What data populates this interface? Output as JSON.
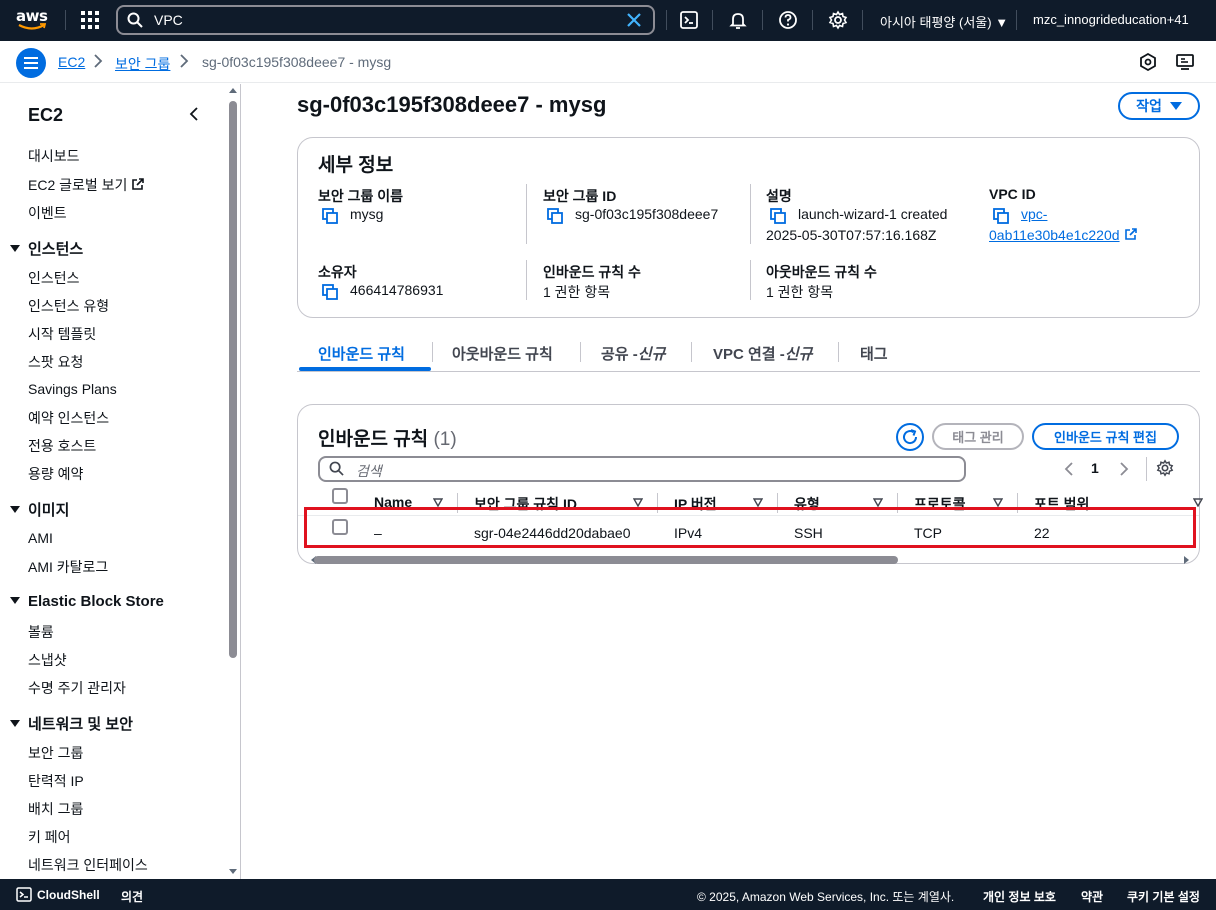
{
  "topnav": {
    "logo_text": "aws",
    "search_value": "VPC",
    "region_label": "아시아 태평양 (서울)",
    "account_label": "mzc_innogrideducation+41"
  },
  "breadcrumb": {
    "items": [
      "EC2",
      "보안 그룹",
      "sg-0f03c195f308deee7 - mysg"
    ]
  },
  "sidebar": {
    "title": "EC2",
    "top_items": [
      "대시보드",
      "EC2 글로벌 보기",
      "이벤트"
    ],
    "sections": [
      {
        "title": "인스턴스",
        "items": [
          "인스턴스",
          "인스턴스 유형",
          "시작 템플릿",
          "스팟 요청",
          "Savings Plans",
          "예약 인스턴스",
          "전용 호스트",
          "용량 예약"
        ]
      },
      {
        "title": "이미지",
        "items": [
          "AMI",
          "AMI 카탈로그"
        ]
      },
      {
        "title": "Elastic Block Store",
        "items": [
          "볼륨",
          "스냅샷",
          "수명 주기 관리자"
        ]
      },
      {
        "title": "네트워크 및 보안",
        "items": [
          "보안 그룹",
          "탄력적 IP",
          "배치 그룹",
          "키 페어",
          "네트워크 인터페이스"
        ]
      }
    ]
  },
  "page": {
    "title": "sg-0f03c195f308deee7 - mysg",
    "action_button": "작업"
  },
  "details": {
    "title": "세부 정보",
    "fields": {
      "sg_name_label": "보안 그룹 이름",
      "sg_name_value": "mysg",
      "sg_id_label": "보안 그룹 ID",
      "sg_id_value": "sg-0f03c195f308deee7",
      "desc_label": "설명",
      "desc_value_line1": "launch-wizard-1 created",
      "desc_value_line2": "2025-05-30T07:57:16.168Z",
      "vpc_label": "VPC ID",
      "vpc_value_line1": "vpc-",
      "vpc_value_line2": "0ab11e30b4e1c220d",
      "owner_label": "소유자",
      "owner_value": "466414786931",
      "inbound_count_label": "인바운드 규칙 수",
      "inbound_count_value": "1 권한 항목",
      "outbound_count_label": "아웃바운드 규칙 수",
      "outbound_count_value": "1 권한 항목"
    }
  },
  "tabs": [
    {
      "label": "인바운드 규칙"
    },
    {
      "label": "아웃바운드 규칙"
    },
    {
      "label": "공유 -",
      "suffix": "신규"
    },
    {
      "label": "VPC 연결 -",
      "suffix": "신규"
    },
    {
      "label": "태그"
    }
  ],
  "rules": {
    "title": "인바운드 규칙",
    "count": "(1)",
    "manage_tags_button": "태그 관리",
    "edit_button": "인바운드 규칙 편집",
    "search_placeholder": "검색",
    "page_number": "1",
    "columns": [
      "Name",
      "보안 그룹 규칙 ID",
      "IP 버전",
      "유형",
      "프로토콜",
      "포트 범위"
    ],
    "rows": [
      {
        "name": "–",
        "rule_id": "sgr-04e2446dd20dabae0",
        "ip_version": "IPv4",
        "type": "SSH",
        "protocol": "TCP",
        "port_range": "22"
      }
    ]
  },
  "footer": {
    "cloudshell": "CloudShell",
    "feedback": "의견",
    "copyright": "© 2025, Amazon Web Services, Inc. 또는 계열사.",
    "privacy": "개인 정보 보호",
    "terms": "약관",
    "cookies": "쿠키 기본 설정"
  },
  "colors": {
    "nav_bg": "#0f1b2a",
    "accent": "#006ce0",
    "highlight_box": "#e0121f"
  }
}
